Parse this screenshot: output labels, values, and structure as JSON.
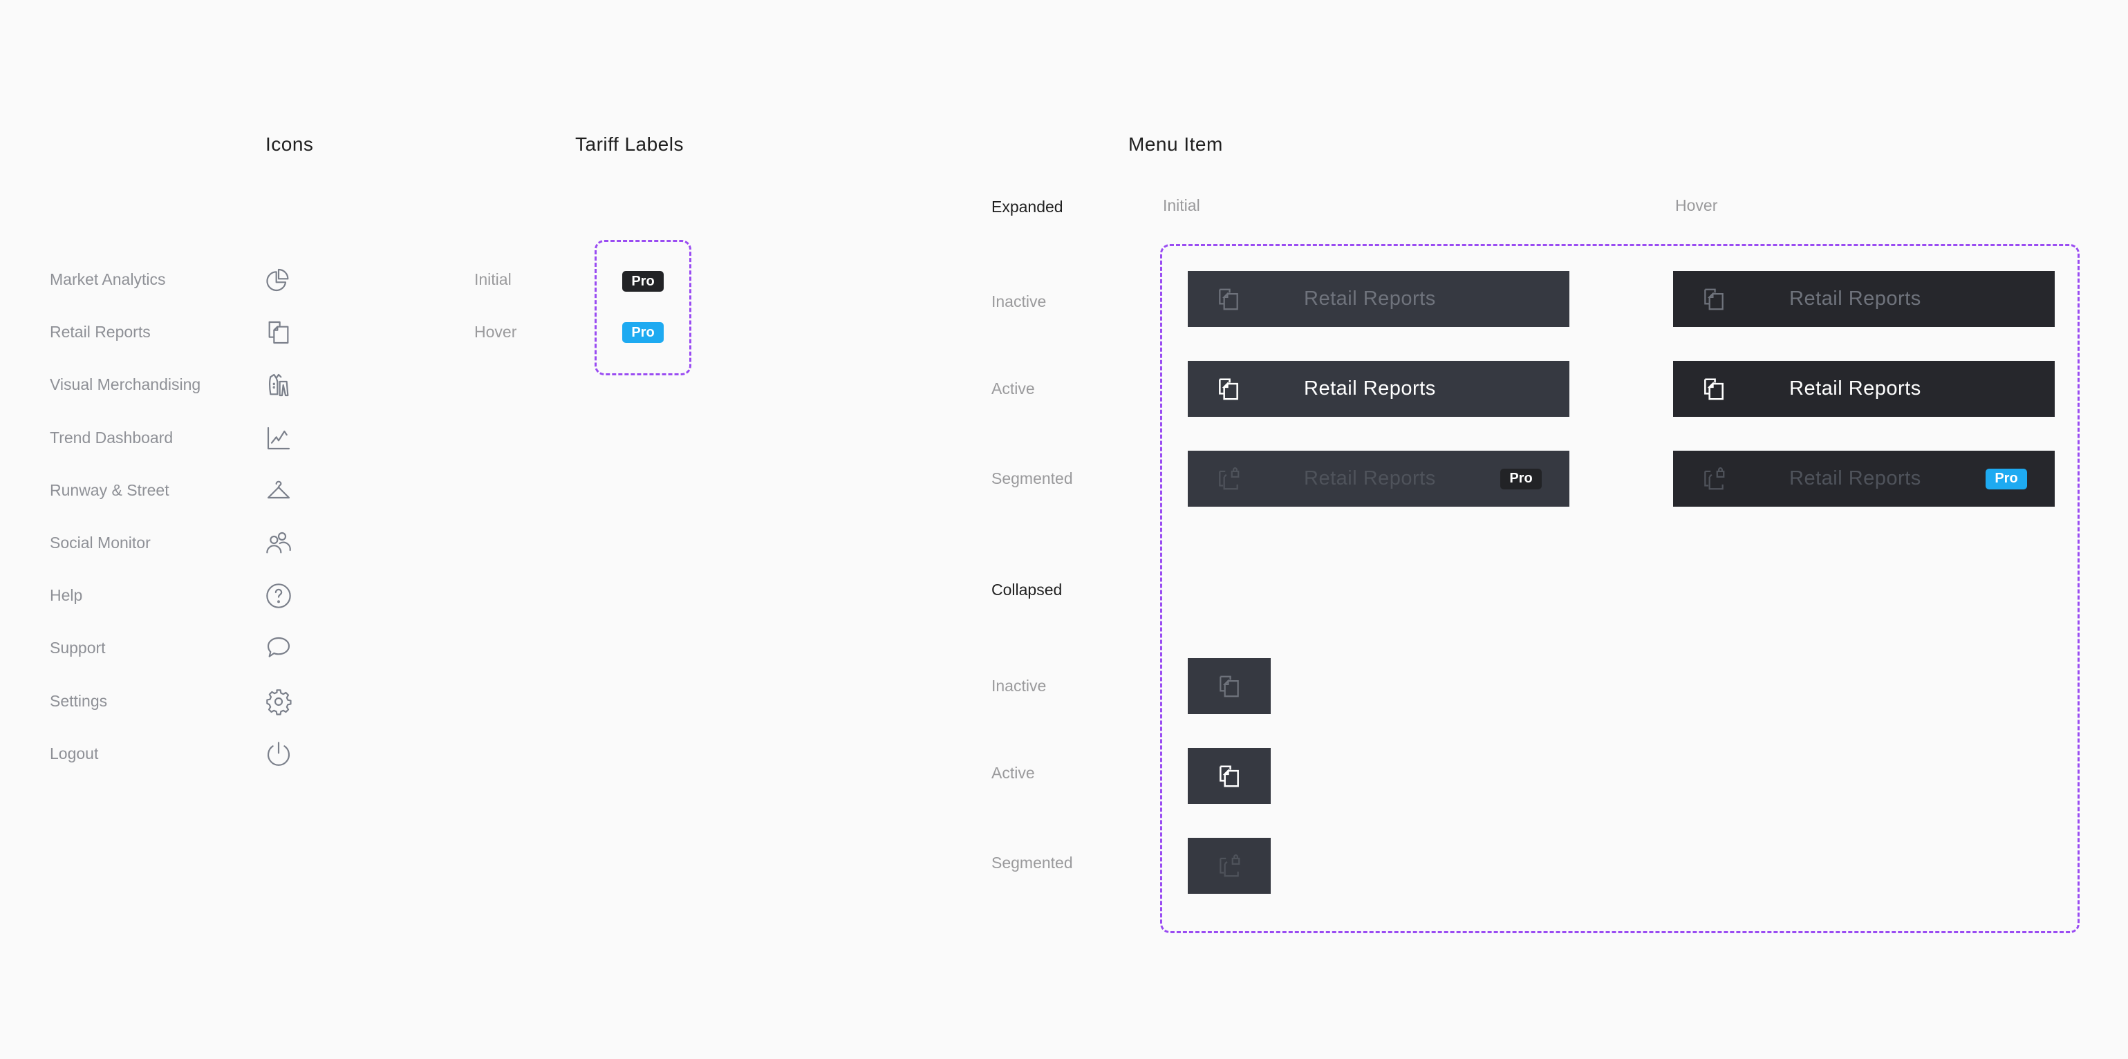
{
  "colors": {
    "background": "#fafafa",
    "dashed_outline": "#9a4cf2",
    "menu_bg_initial": "#363941",
    "menu_bg_hover": "#26272c",
    "text_inactive": "#6f737c",
    "text_active": "#ffffff",
    "text_segmented": "#4f535b",
    "badge_initial": "#222326",
    "badge_hover": "#1eaaf1",
    "icon_gray": "#7a7f8a"
  },
  "icons_section": {
    "title": "Icons",
    "items": [
      {
        "label": "Market Analytics",
        "icon": "pie-chart-icon"
      },
      {
        "label": "Retail Reports",
        "icon": "documents-icon"
      },
      {
        "label": "Visual Merchandising",
        "icon": "suit-icon"
      },
      {
        "label": "Trend Dashboard",
        "icon": "line-chart-icon"
      },
      {
        "label": "Runway & Street",
        "icon": "hanger-icon"
      },
      {
        "label": "Social Monitor",
        "icon": "users-icon"
      },
      {
        "label": "Help",
        "icon": "help-circle-icon"
      },
      {
        "label": "Support",
        "icon": "chat-bubble-icon"
      },
      {
        "label": "Settings",
        "icon": "gear-icon"
      },
      {
        "label": "Logout",
        "icon": "power-icon"
      }
    ]
  },
  "tariff_section": {
    "title": "Tariff Labels",
    "states": [
      {
        "label": "Initial",
        "badge": "Pro"
      },
      {
        "label": "Hover",
        "badge": "Pro"
      }
    ]
  },
  "menu_item_section": {
    "title": "Menu Item",
    "expanded": {
      "label": "Expanded",
      "columns": [
        "Initial",
        "Hover"
      ],
      "rows": [
        {
          "label": "Inactive",
          "item_label": "Retail Reports"
        },
        {
          "label": "Active",
          "item_label": "Retail Reports"
        },
        {
          "label": "Segmented",
          "item_label": "Retail Reports",
          "badge": "Pro"
        }
      ]
    },
    "collapsed": {
      "label": "Collapsed",
      "rows": [
        {
          "label": "Inactive"
        },
        {
          "label": "Active"
        },
        {
          "label": "Segmented"
        }
      ]
    }
  }
}
